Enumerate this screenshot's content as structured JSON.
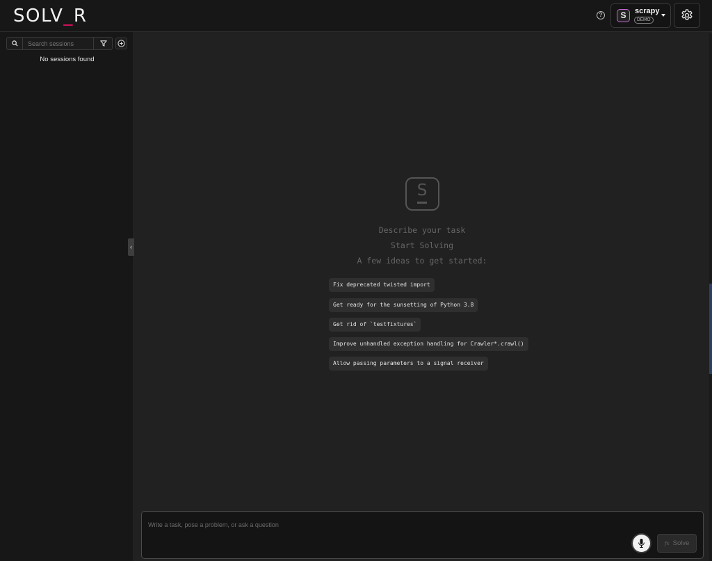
{
  "header": {
    "logo_main": "SOLV",
    "logo_accent": "_",
    "logo_tail": "R",
    "help_glyph": "?",
    "org": {
      "avatar": "S",
      "name": "scrapy",
      "badge": "DEMO"
    }
  },
  "sidebar": {
    "search_placeholder": "Search sessions",
    "empty_message": "No sessions found",
    "collapse_glyph": "‹"
  },
  "main": {
    "logo_letter": "S",
    "prompt_lines": [
      "Describe your task",
      "Start Solving",
      "A few ideas to get started:"
    ],
    "ideas": [
      "Fix deprecated twisted import",
      "Get ready for the sunsetting of Python 3.8",
      "Get rid of `testfixtures`",
      "Improve unhandled exception handling for Crawler*.crawl()",
      "Allow passing parameters to a signal receiver"
    ]
  },
  "composer": {
    "placeholder": "Write a task, pose a problem, or ask a question",
    "solve_icon": "fx",
    "solve_label": "Solve"
  },
  "colors": {
    "accent": "#e0115f",
    "avatar_border": "#c86bd6",
    "background": "#212121",
    "sidebar": "#171717"
  }
}
